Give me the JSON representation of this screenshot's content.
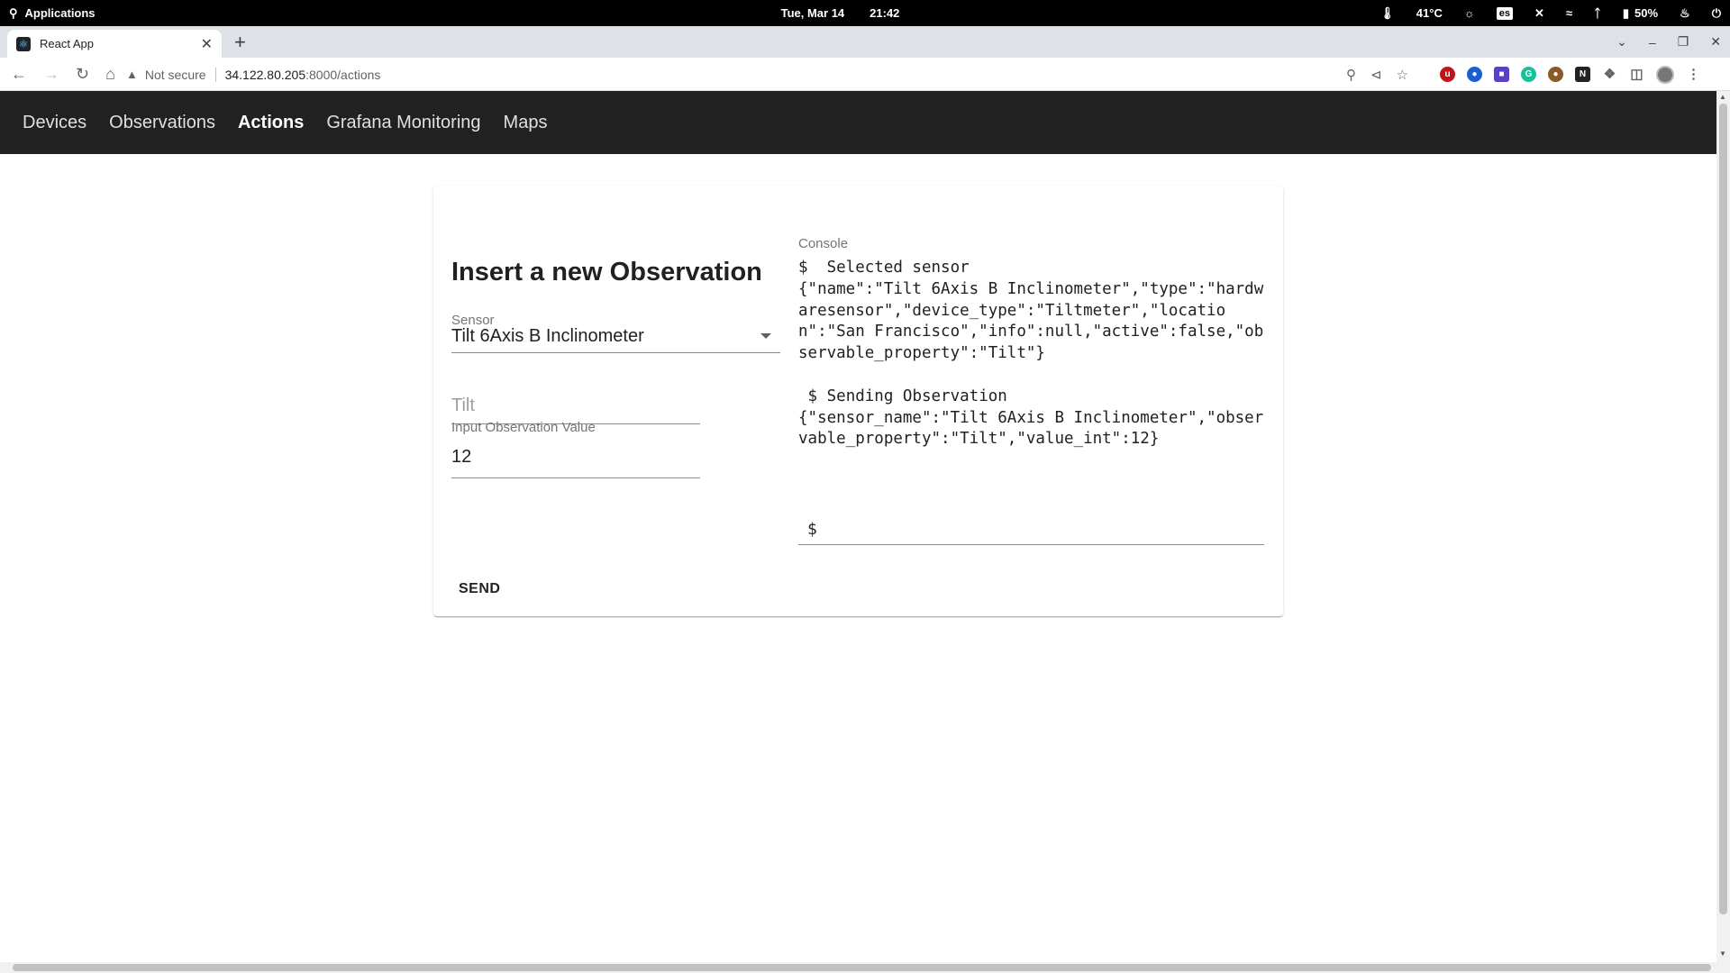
{
  "os": {
    "apps_label": "Applications",
    "date": "Tue, Mar 14",
    "time": "21:42",
    "temperature": "41°C",
    "keyboard_layout": "es",
    "battery": "50%"
  },
  "browser": {
    "tab_title": "React App",
    "security_label": "Not secure",
    "url_host": "34.122.80.205",
    "url_rest": ":8000/actions"
  },
  "nav": {
    "items": [
      {
        "label": "Devices"
      },
      {
        "label": "Observations"
      },
      {
        "label": "Actions"
      },
      {
        "label": "Grafana Monitoring"
      },
      {
        "label": "Maps"
      }
    ]
  },
  "form": {
    "title": "Insert a new Observation",
    "sensor_label": "Sensor",
    "sensor_value": "Tilt 6Axis B Inclinometer",
    "property_placeholder": "Tilt",
    "value_label": "Input Observation Value",
    "value": "12",
    "send_label": "SEND"
  },
  "console": {
    "label": "Console",
    "output": "$  Selected sensor\n{\"name\":\"Tilt 6Axis B Inclinometer\",\"type\":\"hardwaresensor\",\"device_type\":\"Tiltmeter\",\"location\":\"San Francisco\",\"info\":null,\"active\":false,\"observable_property\":\"Tilt\"}\n\n $ Sending Observation\n{\"sensor_name\":\"Tilt 6Axis B Inclinometer\",\"observable_property\":\"Tilt\",\"value_int\":12}",
    "prompt": "$"
  }
}
